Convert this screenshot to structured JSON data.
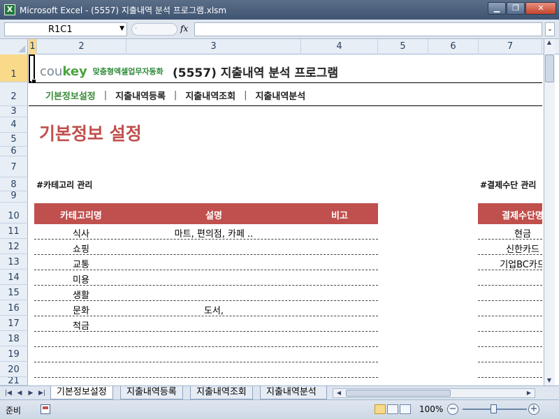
{
  "window": {
    "app_icon": "X",
    "title": "Microsoft Excel - (5557) 지출내역 분석 프로그램.xlsm",
    "controls": [
      "minimize-icon",
      "restore-icon",
      "close-icon"
    ]
  },
  "formula_bar": {
    "name_box": "R1C1",
    "fx_label": "fx",
    "formula": ""
  },
  "columns": [
    "1",
    "2",
    "3",
    "4",
    "5",
    "6",
    "7"
  ],
  "rows": [
    "1",
    "2",
    "3",
    "4",
    "5",
    "6",
    "7",
    "8",
    "9",
    "10",
    "11",
    "12",
    "13",
    "14",
    "15",
    "16",
    "17",
    "18",
    "19",
    "20",
    "21"
  ],
  "header": {
    "logo_cou": "cou",
    "logo_key": "key",
    "logo_tagline": "맞춤형엑셀업무자동화",
    "app_title": "(5557) 지출내역 분석 프로그램"
  },
  "nav": {
    "items": [
      "기본정보설정",
      "지출내역등록",
      "지출내역조회",
      "지출내역분석"
    ],
    "separator": "|",
    "active_index": 0
  },
  "section_title": "기본정보 설정",
  "category": {
    "heading": "#카테고리 관리",
    "columns": [
      "카테고리명",
      "설명",
      "비고"
    ],
    "rows": [
      [
        "식사",
        "마트, 편의점, 카페 ..",
        ""
      ],
      [
        "쇼핑",
        "",
        ""
      ],
      [
        "교통",
        "",
        ""
      ],
      [
        "미용",
        "",
        ""
      ],
      [
        "생활",
        "",
        ""
      ],
      [
        "문화",
        "도서,",
        ""
      ],
      [
        "적금",
        "",
        ""
      ],
      [
        "",
        "",
        ""
      ],
      [
        "",
        "",
        ""
      ],
      [
        "",
        "",
        ""
      ]
    ]
  },
  "payment": {
    "heading": "#결제수단 관리",
    "columns": [
      "결제수단명"
    ],
    "rows": [
      [
        "현금"
      ],
      [
        "신한카드"
      ],
      [
        "기업BC카드"
      ],
      [
        ""
      ],
      [
        ""
      ],
      [
        ""
      ],
      [
        ""
      ],
      [
        ""
      ],
      [
        ""
      ],
      [
        ""
      ]
    ]
  },
  "sheet_tabs": [
    "기본정보설정",
    "지출내역등록",
    "지출내역조회",
    "지출내역분석"
  ],
  "status": {
    "ready": "준비",
    "zoom": "100%",
    "zoom_minus": "−",
    "zoom_plus": "+"
  },
  "colors": {
    "accent_red": "#c0504d",
    "nav_active": "#3a8a3a",
    "selection": "#f9d98a"
  }
}
